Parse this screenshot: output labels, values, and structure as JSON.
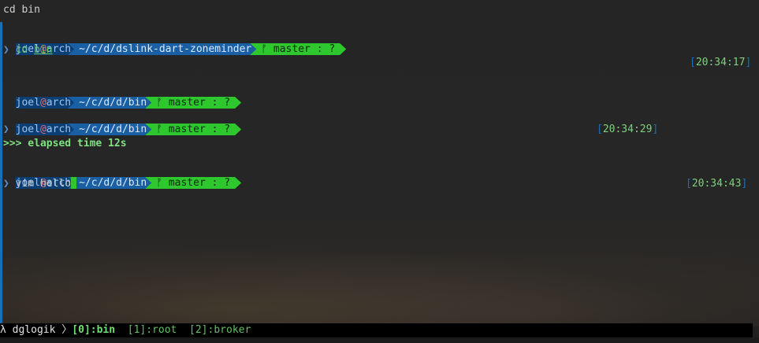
{
  "window": {
    "title": "cd bin"
  },
  "prompt": {
    "user": "joel",
    "at": "@",
    "host": "arch",
    "branch_glyph": "ᚠ",
    "branch_text": "master : ?"
  },
  "blocks": [
    {
      "path": "~/c/d/dslink-dart-zoneminder",
      "command": "cd",
      "arg": "bin",
      "timestamp": "20:34:17"
    },
    {
      "path": "~/c/d/d/bin"
    },
    {
      "path": "~/c/d/d/bin",
      "command": "",
      "timestamp": "20:34:29",
      "elapsed": ">>> elapsed time 12s"
    },
    {
      "path": "~/c/d/d/bin",
      "command": "vim hello",
      "timestamp": "20:34:43"
    }
  ],
  "prompt_arrow": "❯",
  "status_bar": {
    "session": "λ dglogik",
    "separator": "〉",
    "windows": [
      {
        "label": "[0]:bin",
        "active": true
      },
      {
        "label": "[1]:root",
        "active": false
      },
      {
        "label": "[2]:broker",
        "active": false
      }
    ]
  }
}
